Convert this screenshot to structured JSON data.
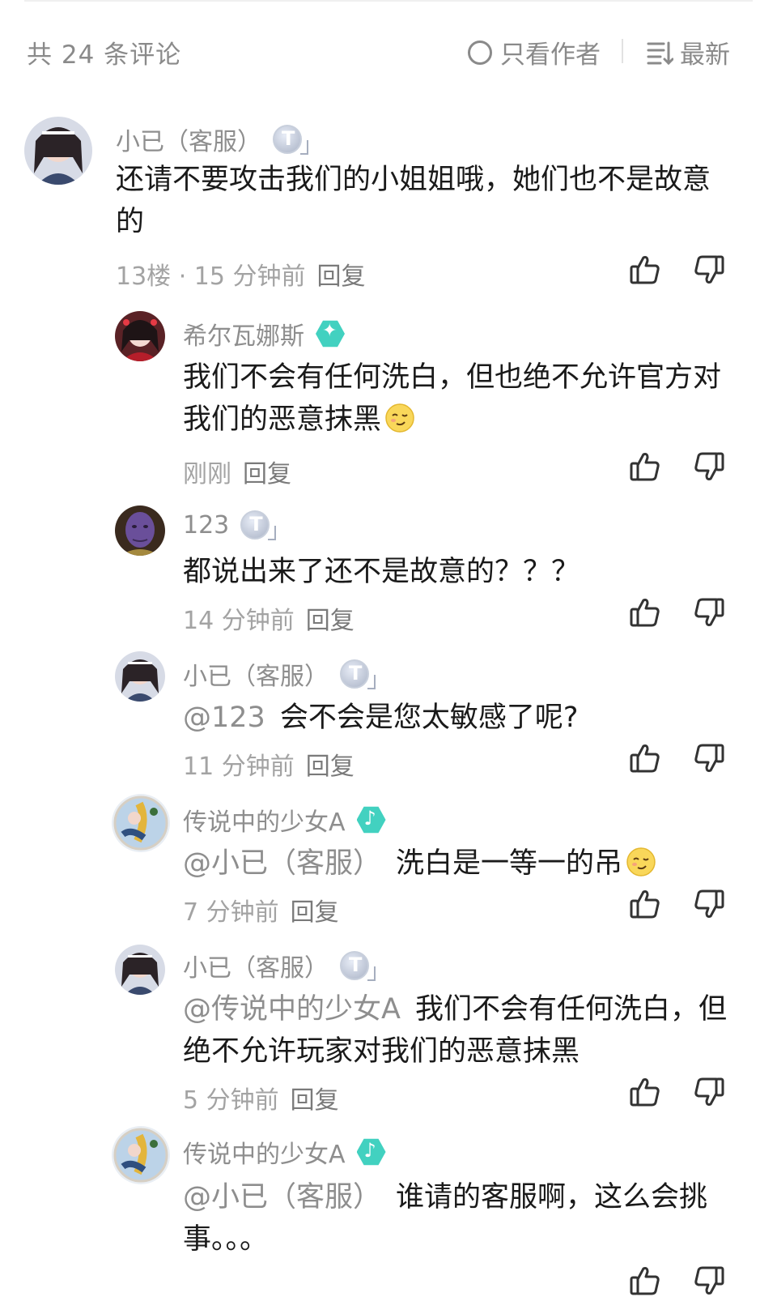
{
  "header": {
    "comment_count": "共 24 条评论",
    "author_only_label": "只看作者",
    "sort_label": "最新"
  },
  "comments": [
    {
      "name": "小已（客服）",
      "text": "还请不要攻击我们的小姐姐哦，她们也不是故意的",
      "meta": "13楼 · 15 分钟前",
      "reply": "回复"
    },
    {
      "name": "希尔瓦娜斯",
      "text": "我们不会有任何洗白，但也绝不允许官方对我们的恶意抹黑",
      "meta": "刚刚",
      "reply": "回复"
    },
    {
      "name": "123",
      "text": "都说出来了还不是故意的？？？",
      "meta": "14 分钟前",
      "reply": "回复"
    },
    {
      "name": "小已（客服）",
      "mention": "@123",
      "text": "会不会是您太敏感了呢?",
      "meta": "11 分钟前",
      "reply": "回复"
    },
    {
      "name": "传说中的少女A",
      "mention": "@小已（客服）",
      "text": "洗白是一等一的吊",
      "meta": "7 分钟前",
      "reply": "回复"
    },
    {
      "name": "小已（客服）",
      "mention": "@传说中的少女A",
      "text": "我们不会有任何洗白，但绝不允许玩家对我们的恶意抹黑",
      "meta": "5 分钟前",
      "reply": "回复"
    },
    {
      "name": "传说中的少女A",
      "mention": "@小已（客服）",
      "text": "谁请的客服啊，这么会挑事。。。"
    }
  ],
  "colors": {
    "secondary_text": "#8e8e8e",
    "badge_teal": "#42d1c0",
    "badge_silver": "#aab3c6"
  }
}
